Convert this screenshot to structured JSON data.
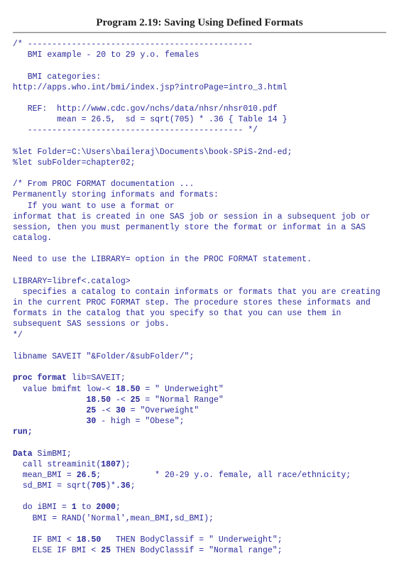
{
  "title": "Program 2.19: Saving Using Defined Formats",
  "code": {
    "c1": "/* ----------------------------------------------",
    "c2": "   BMI example - 20 to 29 y.o. females",
    "c3": "",
    "c4": "   BMI categories:",
    "c5": "http://apps.who.int/bmi/index.jsp?introPage=intro_3.html",
    "c6": "",
    "c7": "   REF:  http://www.cdc.gov/nchs/data/nhsr/nhsr010.pdf",
    "c8": "         mean = 26.5,  sd = sqrt(705) * .36 { Table 14 }",
    "c9": "   -------------------------------------------- */",
    "c10": "",
    "c11": "%let Folder=C:\\Users\\baileraj\\Documents\\book-SPiS-2nd-ed;",
    "c12": "%let subFolder=chapter02;",
    "c13": "",
    "c14": "/* From PROC FORMAT documentation ...",
    "c15": "Permanently storing informats and formats:",
    "c16": "   If you want to use a format or",
    "c17": "informat that is created in one SAS job or session in a subsequent job or session, then you must permanently store the format or informat in a SAS catalog.",
    "c18": "",
    "c19": "Need to use the LIBRARY= option in the PROC FORMAT statement.",
    "c20": "",
    "c21": "LIBRARY=libref<.catalog>",
    "c22": "  specifies a catalog to contain informats or formats that you are creating in the current PROC FORMAT step. The procedure stores these informats and formats in the catalog that you specify so that you can use them in subsequent SAS sessions or jobs.",
    "c23": "*/",
    "c24": "",
    "c25": "libname SAVEIT \"&Folder/&subFolder/\";",
    "c26": "",
    "p1a": "proc",
    "p1b": " format",
    "p1c": " lib=SAVEIT;",
    "p2a": "  value bmifmt low-< ",
    "p2b": "18.50",
    "p2c": " = \" Underweight\"",
    "p3a": "               ",
    "p3b": "18.50",
    "p3c": " -< ",
    "p3d": "25",
    "p3e": " = \"Normal Range\"",
    "p4a": "               ",
    "p4b": "25",
    "p4c": " -< ",
    "p4d": "30",
    "p4e": " = \"Overweight\"",
    "p5a": "               ",
    "p5b": "30",
    "p5c": " - high = \"Obese\";",
    "p6": "run;",
    "p7": "",
    "d1a": "Data",
    "d1b": " SimBMI;",
    "d2a": "  call streaminit(",
    "d2b": "1807",
    "d2c": ");",
    "d3a": "  mean_BMI = ",
    "d3b": "26.5",
    "d3c": ";           * 20-29 y.o. female, all race/ethnicity;",
    "d4a": "  sd_BMI = sqrt(",
    "d4b": "705",
    "d4c": ")*",
    "d4d": ".36",
    "d4e": ";",
    "d5": "",
    "d6a": "  do iBMI = ",
    "d6b": "1",
    "d6c": " to ",
    "d6d": "2000",
    "d6e": ";",
    "d7": "    BMI = RAND('Normal',mean_BMI,sd_BMI);",
    "d8": "",
    "d9a": "    IF BMI < ",
    "d9b": "18.50",
    "d9c": "   THEN BodyClassif = \" Underweight\";",
    "d10a": "    ELSE IF BMI < ",
    "d10b": "25",
    "d10c": " THEN BodyClassif = \"Normal range\";"
  }
}
